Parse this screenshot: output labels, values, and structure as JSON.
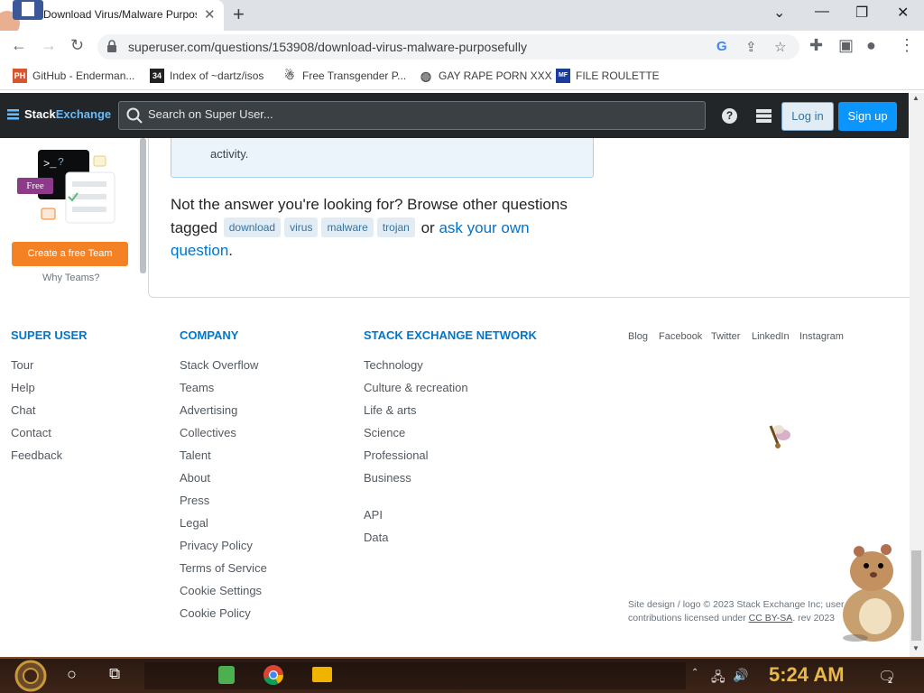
{
  "browser": {
    "tab_title": "Download Virus/Malware Purposefully",
    "url": "superuser.com/questions/153908/download-virus-malware-purposefully",
    "bookmarks": [
      {
        "icon": "PH",
        "label": "GitHub - Enderman..."
      },
      {
        "icon": "34",
        "label": "Index of ~dartz/isos"
      },
      {
        "icon": "ghost",
        "label": "Free Transgender P..."
      },
      {
        "icon": "globe",
        "label": "GAY RAPE PORN XXX"
      },
      {
        "icon": "MF",
        "label": "FILE ROULETTE"
      }
    ]
  },
  "se_header": {
    "logo_stack": "Stack",
    "logo_exchange": "Exchange",
    "search_placeholder": "Search on Super User...",
    "login_label": "Log in",
    "signup_label": "Sign up"
  },
  "sidebar": {
    "free_badge": "Free",
    "create_team_label": "Create a free Team",
    "why_teams_label": "Why Teams?"
  },
  "notice": {
    "text": "activity."
  },
  "browse": {
    "prefix": "Not the answer you're looking for? Browse other questions tagged",
    "tags": [
      "download",
      "virus",
      "malware",
      "trojan"
    ],
    "or_text": "or",
    "ask_link": "ask your own question",
    "suffix": "."
  },
  "footer": {
    "col1": {
      "heading": "SUPER USER",
      "links": [
        "Tour",
        "Help",
        "Chat",
        "Contact",
        "Feedback"
      ]
    },
    "col2": {
      "heading": "COMPANY",
      "links": [
        "Stack Overflow",
        "Teams",
        "Advertising",
        "Collectives",
        "Talent",
        "About",
        "Press",
        "Legal",
        "Privacy Policy",
        "Terms of Service",
        "Cookie Settings",
        "Cookie Policy"
      ]
    },
    "col3": {
      "heading": "STACK EXCHANGE NETWORK",
      "links": [
        "Technology",
        "Culture & recreation",
        "Life & arts",
        "Science",
        "Professional",
        "Business"
      ],
      "links2": [
        "API",
        "Data"
      ]
    },
    "social": [
      "Blog",
      "Facebook",
      "Twitter",
      "LinkedIn",
      "Instagram"
    ],
    "copyright_line1": "Site design / logo © 2023 Stack Exchange Inc; user",
    "copyright_line2_a": "contributions licensed under",
    "copyright_license": "CC BY-SA",
    "copyright_line2_b": ". rev 2023"
  },
  "taskbar": {
    "time": "5:24 AM",
    "notification_count": "2"
  }
}
